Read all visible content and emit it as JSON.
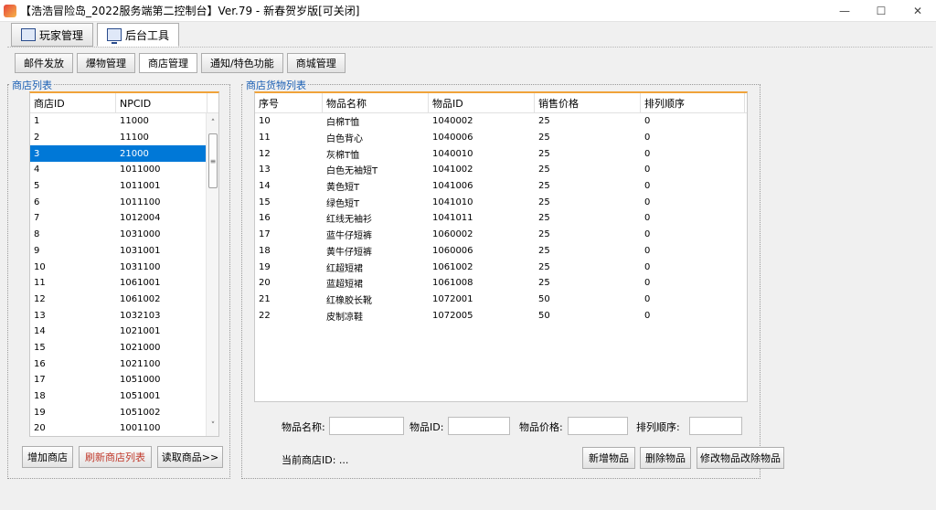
{
  "window": {
    "title": "【浩浩冒险岛_2022服务端第二控制台】Ver.79 - 新春贺岁版[可关闭]",
    "controls": [
      "—",
      "☐",
      "✕"
    ]
  },
  "main_tabs": [
    {
      "label": "玩家管理",
      "icon": "mail-icon"
    },
    {
      "label": "后台工具",
      "icon": "monitor-icon"
    }
  ],
  "sub_tabs": [
    "邮件发放",
    "爆物管理",
    "商店管理",
    "通知/特色功能",
    "商城管理"
  ],
  "shop_list": {
    "title": "商店列表",
    "columns": [
      "商店ID",
      "NPCID"
    ],
    "rows": [
      [
        "1",
        "11000"
      ],
      [
        "2",
        "11100"
      ],
      [
        "3",
        "21000"
      ],
      [
        "4",
        "1011000"
      ],
      [
        "5",
        "1011001"
      ],
      [
        "6",
        "1011100"
      ],
      [
        "7",
        "1012004"
      ],
      [
        "8",
        "1031000"
      ],
      [
        "9",
        "1031001"
      ],
      [
        "10",
        "1031100"
      ],
      [
        "11",
        "1061001"
      ],
      [
        "12",
        "1061002"
      ],
      [
        "13",
        "1032103"
      ],
      [
        "14",
        "1021001"
      ],
      [
        "15",
        "1021000"
      ],
      [
        "16",
        "1021100"
      ],
      [
        "17",
        "1051000"
      ],
      [
        "18",
        "1051001"
      ],
      [
        "19",
        "1051002"
      ],
      [
        "20",
        "1001100"
      ]
    ],
    "selected_index": 2
  },
  "shop_buttons": [
    "增加商店",
    "刷新商店列表",
    "读取商品>>"
  ],
  "goods_list": {
    "title": "商店货物列表",
    "columns": [
      "序号",
      "物品名称",
      "物品ID",
      "销售价格",
      "排列顺序"
    ],
    "rows": [
      [
        "10",
        "白棉T恤",
        "1040002",
        "25",
        "0"
      ],
      [
        "11",
        "白色背心",
        "1040006",
        "25",
        "0"
      ],
      [
        "12",
        "灰棉T恤",
        "1040010",
        "25",
        "0"
      ],
      [
        "13",
        "白色无袖短T",
        "1041002",
        "25",
        "0"
      ],
      [
        "14",
        "黄色短T",
        "1041006",
        "25",
        "0"
      ],
      [
        "15",
        "绿色短T",
        "1041010",
        "25",
        "0"
      ],
      [
        "16",
        "红线无袖衫",
        "1041011",
        "25",
        "0"
      ],
      [
        "17",
        "蓝牛仔短裤",
        "1060002",
        "25",
        "0"
      ],
      [
        "18",
        "黄牛仔短裤",
        "1060006",
        "25",
        "0"
      ],
      [
        "19",
        "红超短裙",
        "1061002",
        "25",
        "0"
      ],
      [
        "20",
        "蓝超短裙",
        "1061008",
        "25",
        "0"
      ],
      [
        "21",
        "红橡胶长靴",
        "1072001",
        "50",
        "0"
      ],
      [
        "22",
        "皮制凉鞋",
        "1072005",
        "50",
        "0"
      ]
    ]
  },
  "form": {
    "item_name_label": "物品名称:",
    "item_id_label": "物品ID:",
    "item_price_label": "物品价格:",
    "order_label": "排列顺序:",
    "current_shop_label": "当前商店ID: ..."
  },
  "goods_buttons": [
    "新增物品",
    "删除物品",
    "修改物品改除物品"
  ]
}
